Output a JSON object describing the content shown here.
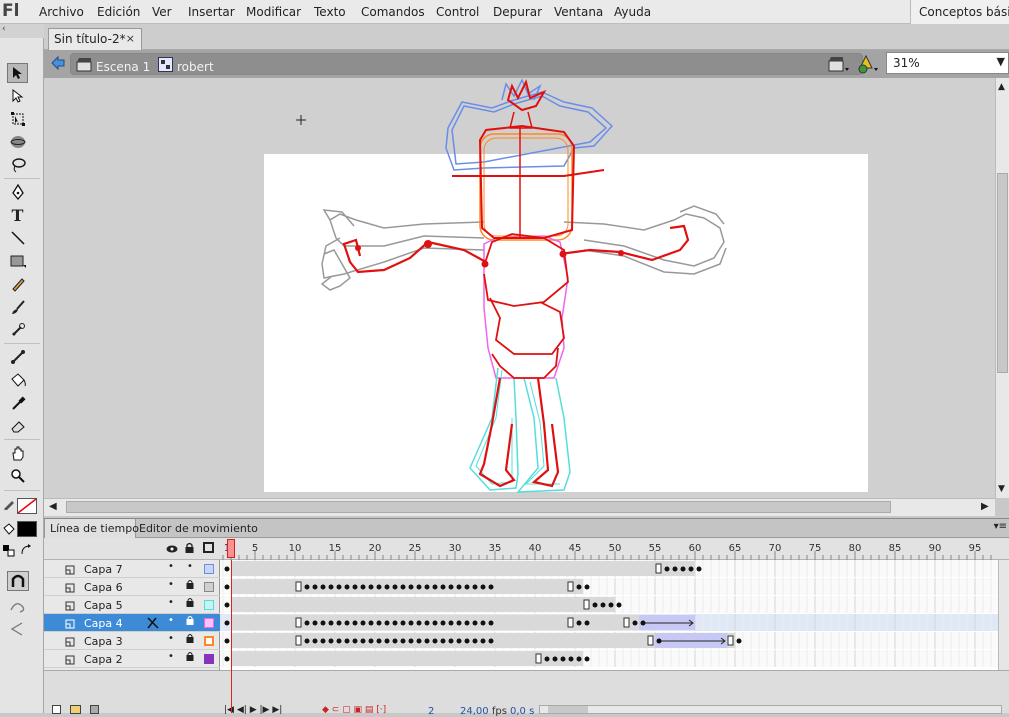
{
  "app": {
    "logo": "Fl"
  },
  "menu": [
    "Archivo",
    "Edición",
    "Ver",
    "Insertar",
    "Modificar",
    "Texto",
    "Comandos",
    "Control",
    "Depurar",
    "Ventana",
    "Ayuda"
  ],
  "workspace_label": "Conceptos básicos",
  "document_tab": {
    "title": "Sin título-2*",
    "close": "×"
  },
  "breadcrumb": {
    "scene": "Escena 1",
    "symbol": "robert"
  },
  "zoom": {
    "value": "31%"
  },
  "timeline": {
    "tabs": [
      "Línea de tiempo",
      "Editor de movimiento"
    ],
    "ruler": [
      "1",
      "5",
      "10",
      "15",
      "20",
      "25",
      "30",
      "35",
      "40",
      "45",
      "50",
      "55",
      "60",
      "65",
      "70",
      "75",
      "80",
      "85",
      "90",
      "95"
    ],
    "playhead_frame": 2,
    "layers": [
      {
        "name": "Capa 7",
        "lock": "•",
        "color": "#6a8ee8",
        "active": false
      },
      {
        "name": "Capa 6",
        "lock": "🔒",
        "color": "#999999",
        "active": false
      },
      {
        "name": "Capa 5",
        "lock": "🔒",
        "color": "#55dddd",
        "active": false
      },
      {
        "name": "Capa 4",
        "lock": "🔒",
        "color": "#ee66ee",
        "active": true
      },
      {
        "name": "Capa 3",
        "lock": "🔒",
        "color": "#ff8822",
        "active": false
      },
      {
        "name": "Capa 2",
        "lock": "🔒",
        "color": "#8833bb",
        "active": false
      }
    ],
    "status": {
      "frame": "2",
      "fps": "24,00",
      "fps_unit": "fps",
      "time": "0,0 s"
    }
  },
  "icons": {
    "tools": [
      "selection-tool-icon",
      "subselection-tool-icon",
      "free-transform-icon",
      "3d-rotation-icon",
      "lasso-icon",
      "pen-icon",
      "text-tool-icon",
      "line-tool-icon",
      "rectangle-tool-icon",
      "pencil-icon",
      "brush-icon",
      "deco-icon",
      "bone-icon",
      "paint-bucket-icon",
      "eyedropper-icon",
      "eraser-icon",
      "hand-icon",
      "zoom-icon"
    ]
  }
}
